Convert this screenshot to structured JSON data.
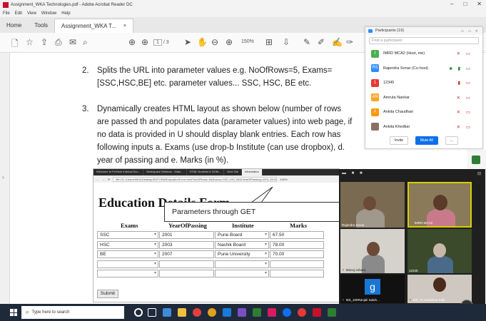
{
  "window": {
    "title": "Assignment_WKA Technologies.pdf - Adobe Acrobat Reader DC",
    "controls": [
      "–",
      "□",
      "✕"
    ]
  },
  "menu": [
    "File",
    "Edit",
    "View",
    "Window",
    "Help"
  ],
  "tabs": {
    "home": "Home",
    "tools": "Tools",
    "document": "Assignment_WKA T...",
    "close": "×"
  },
  "toolbar": {
    "page_current": "1",
    "page_total": "/ 3",
    "zoom": "150%"
  },
  "document": {
    "items": [
      {
        "num": "2.",
        "text": "Splits the URL into parameter values e.g. NoOfRows=5, Exams=[SSC,HSC,BE] etc. parameter values... SSC, HSC, BE etc."
      },
      {
        "num": "3.",
        "text": "Dynamically creates HTML layout as shown below (number of rows are passed th and populates data (parameter values) into web page, if no data is provided in U should display blank entries. Each row has following inputs a. Exams (use drop-b Institute (can use dropbox), d. year of passing and e. Marks (in %)."
      }
    ]
  },
  "embedded_browser": {
    "tabs": [
      "Welcome to FinTech Internal Sur...",
      "Workspace Webinar - Main...",
      "HTML Nodelist & DOM...",
      "New Tab",
      "Information"
    ],
    "url": "file:///C:/Users/WKA/Desktop/EDFORM/EducationForm.html?NoOfRows=5&Exams=SSC,HSC,BE&YearOfPassing=2001,2003,2007&Institute=Pune Board,Nashik Board,Pune University&Marks=67.50,78.00,70.00",
    "zoom": "100%",
    "form_title": "Education Details Form",
    "columns": [
      "Exams",
      "YearOfPassing",
      "Institute",
      "Marks"
    ],
    "rows": [
      [
        "SSC",
        "2001",
        "Pune Board",
        "67.50"
      ],
      [
        "HSC",
        "2003",
        "Nashik Board",
        "78.00"
      ],
      [
        "BE",
        "2007",
        "Pune University",
        "70.00"
      ],
      [
        "",
        "",
        "",
        ""
      ],
      [
        "",
        "",
        "",
        ""
      ]
    ],
    "submit_label": "Submit"
  },
  "callout": "Parameters through GET",
  "participants_panel": {
    "title": "Participants (19)",
    "search_placeholder": "Find a participant",
    "people": [
      {
        "initial": "I",
        "name": "IMRD MCA2 (Host, me)",
        "color": "#4caf50"
      },
      {
        "initial": "RS",
        "name": "Rajendra Sonar (Co-host)",
        "color": "#2d8cff"
      },
      {
        "initial": "1",
        "name": "12345",
        "color": "#e53935"
      },
      {
        "initial": "AN",
        "name": "Amruta Nankar",
        "color": "#f5a623"
      },
      {
        "initial": "A",
        "name": "Ankita Chaudhari",
        "color": "#ff9800"
      },
      {
        "initial": "",
        "name": "Ankita Khedkar",
        "color": "#8d6e63"
      }
    ],
    "invite_label": "Invite",
    "mute_all_label": "Mute All",
    "more_label": "..."
  },
  "video_gallery": {
    "tiles": [
      {
        "name": "Rajendra Sonar",
        "muted": false
      },
      {
        "name": "IMRD MCA2",
        "muted": true
      },
      {
        "name": "Manoj Ashara",
        "muted": true
      },
      {
        "name": "12345",
        "muted": false
      },
      {
        "name": "MS_100Ranjali Saluh...",
        "muted": true,
        "initial": "g"
      },
      {
        "name": "MS_71 Karishma Patil",
        "muted": true
      }
    ],
    "next_label": "›"
  },
  "taskbar": {
    "search_placeholder": "Type here to search"
  },
  "colors": {
    "acrobat_red": "#c8102e",
    "zoom_blue": "#2d8cff",
    "taskbar": "#1e2a3a",
    "gallery_bg": "#1f1f1f"
  }
}
